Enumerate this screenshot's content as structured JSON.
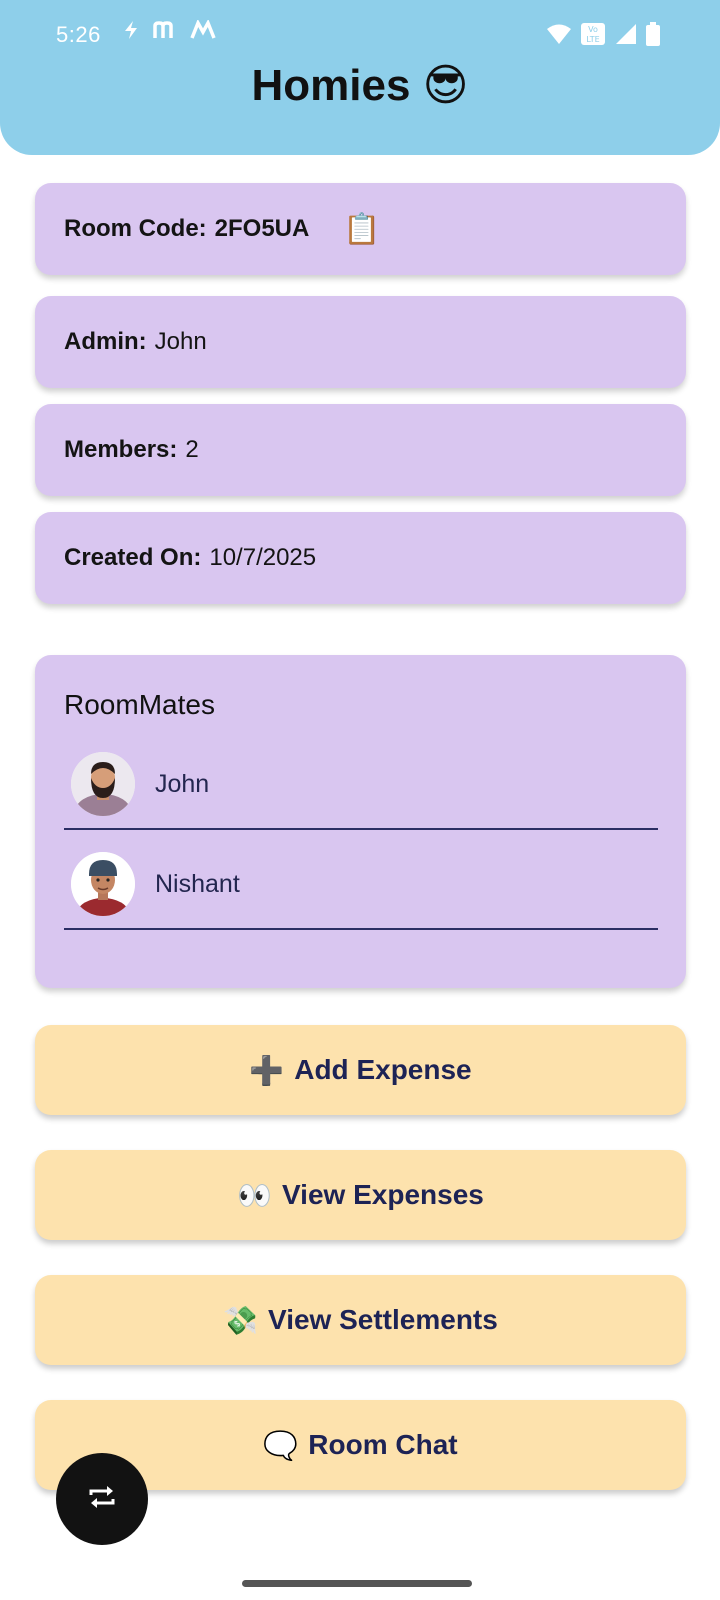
{
  "status_bar": {
    "time": "5:26",
    "left_icons": [
      "flash-icon",
      "m-icon",
      "m-logo-icon"
    ],
    "right_icons": [
      "wifi-icon",
      "volte-icon",
      "signal-icon",
      "battery-icon"
    ]
  },
  "header": {
    "title": "Homies 😎",
    "background_color": "#8ecfea"
  },
  "room_info": {
    "room_code_label": "Room Code:",
    "room_code_value": "2FO5UA",
    "copy_icon": "📋",
    "admin_label": "Admin:",
    "admin_value": "John",
    "members_label": "Members:",
    "members_value": "2",
    "created_label": "Created On:",
    "created_value": "10/7/2025"
  },
  "roommates": {
    "title": "RoomMates",
    "list": [
      {
        "name": "John",
        "avatar": "bearded-man-avatar"
      },
      {
        "name": "Nishant",
        "avatar": "young-man-cap-avatar"
      }
    ]
  },
  "actions": {
    "add_expense": {
      "emoji": "➕",
      "label": "Add Expense"
    },
    "view_expenses": {
      "emoji": "👀",
      "label": "View Expenses"
    },
    "view_settlements": {
      "emoji": "💸",
      "label": "View Settlements"
    },
    "room_chat": {
      "emoji": "🗨️",
      "label": "Room Chat"
    }
  },
  "fab": {
    "icon": "swap-icon"
  },
  "colors": {
    "card_purple": "#d9c6f0",
    "button_yellow": "#fde2ad",
    "button_text": "#1d2355"
  }
}
